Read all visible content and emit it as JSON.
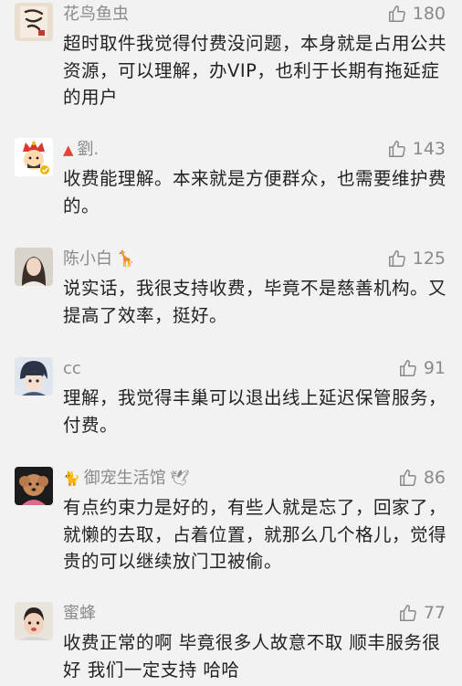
{
  "comments": [
    {
      "name": "花鸟鱼虫",
      "badge": "",
      "emoji": "",
      "likes": "180",
      "text": "超时取件我觉得付费没问题，本身就是占用公共资源，可以理解，办VIP，也利于长期有拖延症的用户",
      "avatar": "calligraphy-avatar"
    },
    {
      "name": "劉.",
      "badge": "▲",
      "emoji": "",
      "likes": "143",
      "text": "收费能理解。本来就是方便群众，也需要维护费的。",
      "avatar": "cartoon-emperor-avatar"
    },
    {
      "name": "陈小白",
      "badge": "",
      "emoji": "🦒",
      "likes": "125",
      "text": "说实话，我很支持收费，毕竟不是慈善机构。又提高了效率，挺好。",
      "avatar": "portrait-avatar"
    },
    {
      "name": "cc",
      "badge": "",
      "emoji": "",
      "likes": "91",
      "text": "理解，我觉得丰巢可以退出线上延迟保管服务，付费。",
      "avatar": "anime-avatar"
    },
    {
      "name": "御宠生活馆",
      "badge": "🐈",
      "emoji": "🕊",
      "likes": "86",
      "text": "有点约束力是好的，有些人就是忘了，回家了，就懒的去取，占着位置，就那么几个格儿，觉得贵的可以继续放门卫被偷。",
      "avatar": "dog-avatar"
    },
    {
      "name": "蜜蜂",
      "badge": "",
      "emoji": "",
      "likes": "77",
      "text": "收费正常的啊 毕竟很多人故意不取 顺丰服务很好 我们一定支持 哈哈",
      "avatar": "baby-avatar"
    }
  ],
  "colors": {
    "background": "#f2f2f2",
    "name": "#8a8a8a",
    "text": "#222222",
    "like": "#8a8a8a"
  },
  "icons": {
    "like": "thumbs-up-icon"
  }
}
